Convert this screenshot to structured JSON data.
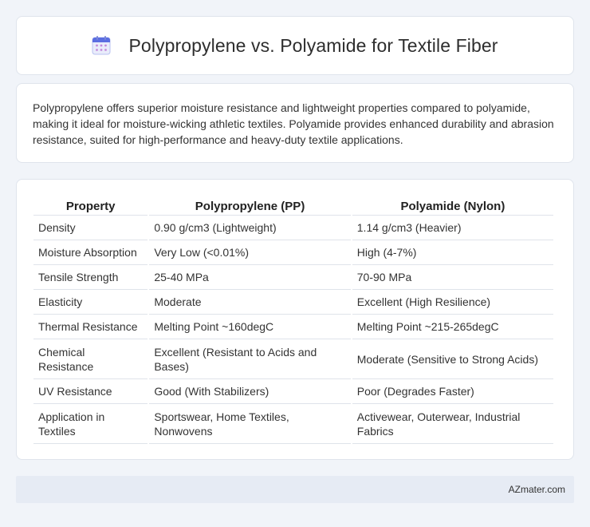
{
  "header": {
    "icon": "calendar-icon",
    "title": "Polypropylene vs. Polyamide for Textile Fiber"
  },
  "summary": {
    "text": "Polypropylene offers superior moisture resistance and lightweight properties compared to polyamide, making it ideal for moisture-wicking athletic textiles. Polyamide provides enhanced durability and abrasion resistance, suited for high-performance and heavy-duty textile applications."
  },
  "table": {
    "headers": [
      "Property",
      "Polypropylene (PP)",
      "Polyamide (Nylon)"
    ],
    "rows": [
      [
        "Density",
        "0.90 g/cm3 (Lightweight)",
        "1.14 g/cm3 (Heavier)"
      ],
      [
        "Moisture Absorption",
        "Very Low (<0.01%)",
        "High (4-7%)"
      ],
      [
        "Tensile Strength",
        "25-40 MPa",
        "70-90 MPa"
      ],
      [
        "Elasticity",
        "Moderate",
        "Excellent (High Resilience)"
      ],
      [
        "Thermal Resistance",
        "Melting Point ~160degC",
        "Melting Point ~215-265degC"
      ],
      [
        "Chemical Resistance",
        "Excellent (Resistant to Acids and Bases)",
        "Moderate (Sensitive to Strong Acids)"
      ],
      [
        "UV Resistance",
        "Good (With Stabilizers)",
        "Poor (Degrades Faster)"
      ],
      [
        "Application in Textiles",
        "Sportswear, Home Textiles, Nonwovens",
        "Activewear, Outerwear, Industrial Fabrics"
      ]
    ]
  },
  "footer": {
    "brand": "AZmater.com"
  },
  "colors": {
    "background": "#f1f4f9",
    "card": "#ffffff",
    "footer_bar": "#e6ebf4",
    "icon_accent": "#5b6ee1"
  }
}
